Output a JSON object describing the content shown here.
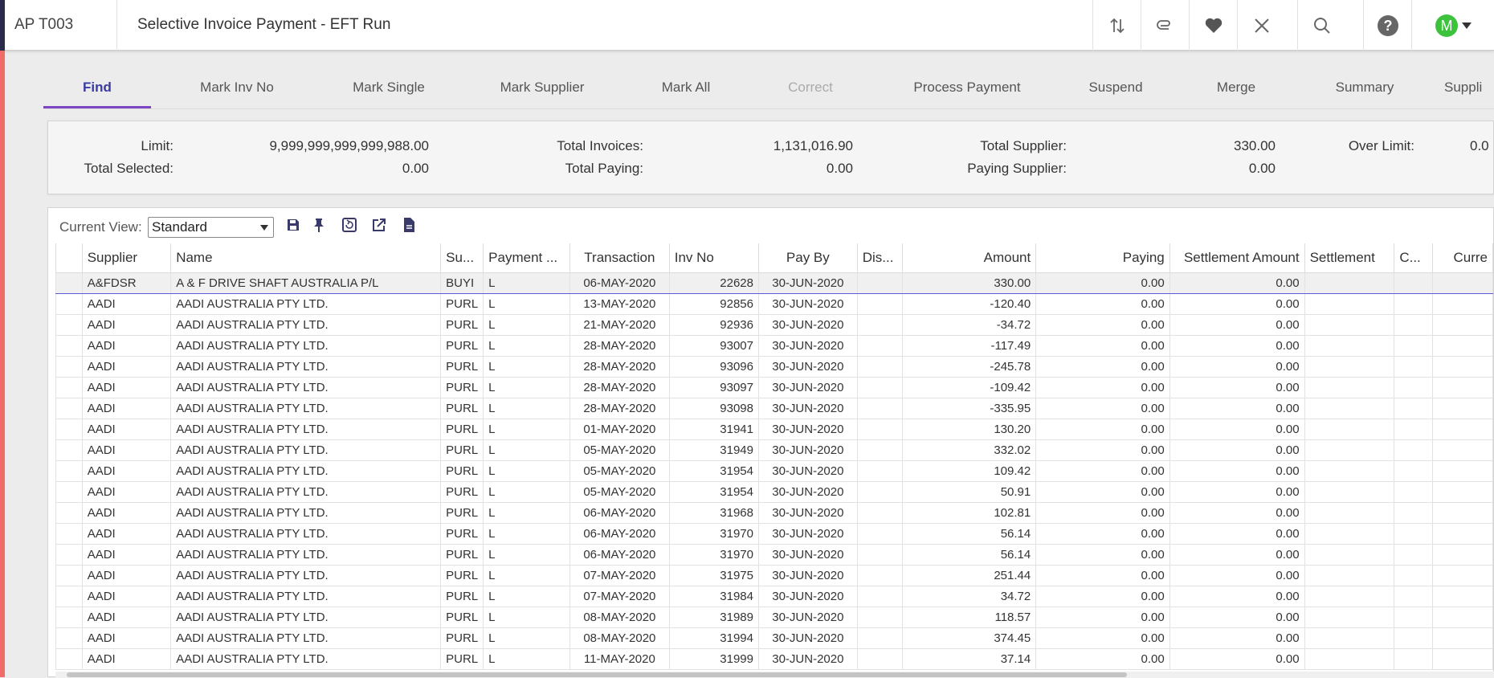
{
  "header": {
    "code": "AP T003",
    "title": "Selective Invoice Payment - EFT Run",
    "avatar_letter": "M",
    "avatar_color": "#3cc23c"
  },
  "tabs": [
    {
      "label": "Find",
      "active": true
    },
    {
      "label": "Mark Inv No"
    },
    {
      "label": "Mark Single"
    },
    {
      "label": "Mark Supplier"
    },
    {
      "label": "Mark All"
    },
    {
      "label": "Correct",
      "disabled": true
    },
    {
      "label": "Process Payment"
    },
    {
      "label": "Suspend"
    },
    {
      "label": "Merge"
    },
    {
      "label": "Summary"
    },
    {
      "label": "Suppli"
    }
  ],
  "totals": {
    "limit_label": "Limit:",
    "limit_value": "9,999,999,999,999,988.00",
    "total_selected_label": "Total Selected:",
    "total_selected_value": "0.00",
    "total_invoices_label": "Total Invoices:",
    "total_invoices_value": "1,131,016.90",
    "total_paying_label": "Total Paying:",
    "total_paying_value": "0.00",
    "total_supplier_label": "Total Supplier:",
    "total_supplier_value": "330.00",
    "paying_supplier_label": "Paying Supplier:",
    "paying_supplier_value": "0.00",
    "over_limit_label": "Over Limit:",
    "over_limit_value": "0.0"
  },
  "view": {
    "label": "Current View:",
    "selected": "Standard"
  },
  "grid": {
    "columns": [
      "Supplier",
      "Name",
      "Su...",
      "Payment ...",
      "Transaction",
      "Inv No",
      "Pay By",
      "Dis...",
      "Amount",
      "Paying",
      "Settlement Amount",
      "Settlement",
      "C...",
      "Curre"
    ],
    "rows": [
      [
        "A&FDSR",
        "A & F DRIVE SHAFT AUSTRALIA P/L",
        "BUYI",
        "L",
        "06-MAY-2020",
        "22628",
        "30-JUN-2020",
        "",
        "330.00",
        "0.00",
        "0.00",
        "",
        "",
        ""
      ],
      [
        "AADI",
        "AADI  AUSTRALIA  PTY LTD.",
        "PURL",
        "L",
        "13-MAY-2020",
        "92856",
        "30-JUN-2020",
        "",
        "-120.40",
        "0.00",
        "0.00",
        "",
        "",
        ""
      ],
      [
        "AADI",
        "AADI  AUSTRALIA  PTY LTD.",
        "PURL",
        "L",
        "21-MAY-2020",
        "92936",
        "30-JUN-2020",
        "",
        "-34.72",
        "0.00",
        "0.00",
        "",
        "",
        ""
      ],
      [
        "AADI",
        "AADI  AUSTRALIA  PTY LTD.",
        "PURL",
        "L",
        "28-MAY-2020",
        "93007",
        "30-JUN-2020",
        "",
        "-117.49",
        "0.00",
        "0.00",
        "",
        "",
        ""
      ],
      [
        "AADI",
        "AADI  AUSTRALIA  PTY LTD.",
        "PURL",
        "L",
        "28-MAY-2020",
        "93096",
        "30-JUN-2020",
        "",
        "-245.78",
        "0.00",
        "0.00",
        "",
        "",
        ""
      ],
      [
        "AADI",
        "AADI  AUSTRALIA  PTY LTD.",
        "PURL",
        "L",
        "28-MAY-2020",
        "93097",
        "30-JUN-2020",
        "",
        "-109.42",
        "0.00",
        "0.00",
        "",
        "",
        ""
      ],
      [
        "AADI",
        "AADI  AUSTRALIA  PTY LTD.",
        "PURL",
        "L",
        "28-MAY-2020",
        "93098",
        "30-JUN-2020",
        "",
        "-335.95",
        "0.00",
        "0.00",
        "",
        "",
        ""
      ],
      [
        "AADI",
        "AADI  AUSTRALIA  PTY LTD.",
        "PURL",
        "L",
        "01-MAY-2020",
        "31941",
        "30-JUN-2020",
        "",
        "130.20",
        "0.00",
        "0.00",
        "",
        "",
        ""
      ],
      [
        "AADI",
        "AADI  AUSTRALIA  PTY LTD.",
        "PURL",
        "L",
        "05-MAY-2020",
        "31949",
        "30-JUN-2020",
        "",
        "332.02",
        "0.00",
        "0.00",
        "",
        "",
        ""
      ],
      [
        "AADI",
        "AADI  AUSTRALIA  PTY LTD.",
        "PURL",
        "L",
        "05-MAY-2020",
        "31954",
        "30-JUN-2020",
        "",
        "109.42",
        "0.00",
        "0.00",
        "",
        "",
        ""
      ],
      [
        "AADI",
        "AADI  AUSTRALIA  PTY LTD.",
        "PURL",
        "L",
        "05-MAY-2020",
        "31954",
        "30-JUN-2020",
        "",
        "50.91",
        "0.00",
        "0.00",
        "",
        "",
        ""
      ],
      [
        "AADI",
        "AADI  AUSTRALIA  PTY LTD.",
        "PURL",
        "L",
        "06-MAY-2020",
        "31968",
        "30-JUN-2020",
        "",
        "102.81",
        "0.00",
        "0.00",
        "",
        "",
        ""
      ],
      [
        "AADI",
        "AADI  AUSTRALIA  PTY LTD.",
        "PURL",
        "L",
        "06-MAY-2020",
        "31970",
        "30-JUN-2020",
        "",
        "56.14",
        "0.00",
        "0.00",
        "",
        "",
        ""
      ],
      [
        "AADI",
        "AADI  AUSTRALIA  PTY LTD.",
        "PURL",
        "L",
        "06-MAY-2020",
        "31970",
        "30-JUN-2020",
        "",
        "56.14",
        "0.00",
        "0.00",
        "",
        "",
        ""
      ],
      [
        "AADI",
        "AADI  AUSTRALIA  PTY LTD.",
        "PURL",
        "L",
        "07-MAY-2020",
        "31975",
        "30-JUN-2020",
        "",
        "251.44",
        "0.00",
        "0.00",
        "",
        "",
        ""
      ],
      [
        "AADI",
        "AADI  AUSTRALIA  PTY LTD.",
        "PURL",
        "L",
        "07-MAY-2020",
        "31984",
        "30-JUN-2020",
        "",
        "34.72",
        "0.00",
        "0.00",
        "",
        "",
        ""
      ],
      [
        "AADI",
        "AADI  AUSTRALIA  PTY LTD.",
        "PURL",
        "L",
        "08-MAY-2020",
        "31989",
        "30-JUN-2020",
        "",
        "118.57",
        "0.00",
        "0.00",
        "",
        "",
        ""
      ],
      [
        "AADI",
        "AADI  AUSTRALIA  PTY LTD.",
        "PURL",
        "L",
        "08-MAY-2020",
        "31994",
        "30-JUN-2020",
        "",
        "374.45",
        "0.00",
        "0.00",
        "",
        "",
        ""
      ],
      [
        "AADI",
        "AADI  AUSTRALIA  PTY LTD.",
        "PURL",
        "L",
        "11-MAY-2020",
        "31999",
        "30-JUN-2020",
        "",
        "37.14",
        "0.00",
        "0.00",
        "",
        "",
        ""
      ]
    ]
  }
}
